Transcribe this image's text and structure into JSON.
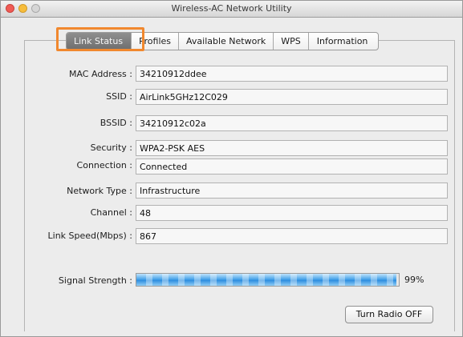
{
  "window": {
    "title": "Wireless-AC Network Utility"
  },
  "tabs": [
    {
      "label": "Link Status",
      "active": true
    },
    {
      "label": "Profiles",
      "active": false
    },
    {
      "label": "Available Network",
      "active": false
    },
    {
      "label": "WPS",
      "active": false
    },
    {
      "label": "Information",
      "active": false
    }
  ],
  "fields": {
    "mac_address": {
      "label": "MAC Address :",
      "value": "34210912ddee"
    },
    "ssid": {
      "label": "SSID :",
      "value": "AirLink5GHz12C029"
    },
    "bssid": {
      "label": "BSSID :",
      "value": "34210912c02a"
    },
    "security": {
      "label": "Security :",
      "value": "WPA2-PSK AES"
    },
    "connection": {
      "label": "Connection :",
      "value": "Connected"
    },
    "network_type": {
      "label": "Network Type :",
      "value": "Infrastructure"
    },
    "channel": {
      "label": "Channel :",
      "value": "48"
    },
    "link_speed": {
      "label": "Link Speed(Mbps) :",
      "value": "867"
    }
  },
  "signal": {
    "label": "Signal Strength :",
    "percent_text": "99%",
    "level": 0.99
  },
  "buttons": {
    "radio_label": "Turn Radio OFF"
  },
  "colors": {
    "highlight": "#f1882e",
    "signal_bar": "#3b9be6",
    "active_tab": "#7d7d7d"
  }
}
